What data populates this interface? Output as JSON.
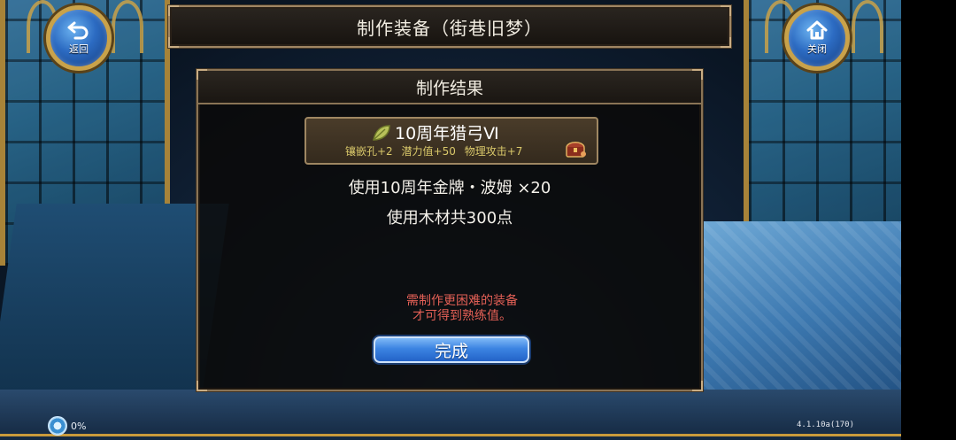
{
  "header": {
    "title": "制作装备（街巷旧梦）",
    "back_label": "返回",
    "close_label": "关闭"
  },
  "panel": {
    "title": "制作结果",
    "item": {
      "name": "10周年猎弓Ⅵ",
      "stats": [
        "镶嵌孔+2",
        "潜力值+50",
        "物理攻击+7"
      ],
      "name_color": "#ffffff",
      "stat_color": "#d9c86a"
    },
    "materials": {
      "medal_line": "使用10周年金牌・波姆 ×20",
      "wood_line": "使用木材共300点"
    },
    "warning": {
      "line1": "需制作更困难的装备",
      "line2": "才可得到熟练值。",
      "color": "#e46056"
    },
    "done_label": "完成"
  },
  "status": {
    "loading_percent": "0%",
    "version": "4.1.10a(170)"
  },
  "icons": {
    "back": "back-arrow-icon",
    "close": "home-icon",
    "item": "leaf-icon",
    "chest": "treasure-chest-icon",
    "loading": "loading-orb-icon"
  }
}
